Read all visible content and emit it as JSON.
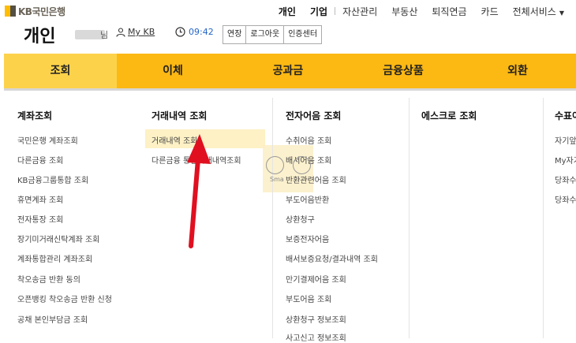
{
  "brand": {
    "logo_text": "KB국민은행"
  },
  "top_nav": {
    "items": [
      "개인",
      "기업",
      "자산관리",
      "부동산",
      "퇴직연금",
      "카드",
      "전체서비스"
    ]
  },
  "header": {
    "page_title": "개인",
    "user_suffix": "님",
    "mykb_label": "My KB",
    "time": "09:42",
    "buttons": [
      "연장",
      "로그아웃",
      "인증센터"
    ]
  },
  "main_nav": {
    "tabs": [
      "조회",
      "이체",
      "공과금",
      "금융상품",
      "외환"
    ],
    "active_index": 0
  },
  "menu": {
    "col1": {
      "title": "계좌조회",
      "items": [
        "국민은행 계좌조회",
        "다른금융 조회",
        "KB금융그룹통합 조회",
        "휴면계좌 조회",
        "전자통장 조회",
        "장기미거래신탁계좌 조회",
        "계좌통합관리 계좌조회",
        "착오송금 반환 동의",
        "오픈뱅킹 착오송금 반환 신청",
        "공채 본인부담금 조회"
      ]
    },
    "col2": {
      "title": "거래내역 조회",
      "items": [
        "거래내역 조회",
        "다른금융 통합거래내역조회"
      ]
    },
    "col3": {
      "title": "전자어음 조회",
      "items": [
        "수취어음 조회",
        "배서어음 조회",
        "반환관련어음 조회",
        "부도어음반환",
        "상환청구",
        "보증전자어음",
        "배서보증요청/결과내역 조회",
        "만기결제어음 조회",
        "부도어음 조회",
        "상환청구 정보조회",
        "사고신고 정보조회"
      ]
    },
    "col4": {
      "title": "에스크로 조회"
    },
    "col5": {
      "title": "수표어",
      "items": [
        "자기앞",
        "My자기",
        "당좌수",
        "당좌수"
      ]
    },
    "overlay_label": "Sma"
  },
  "colors": {
    "brand_yellow": "#fcb813",
    "active_tab": "#fdd24b",
    "arrow_red": "#e01020",
    "time_blue": "#2565c5"
  }
}
